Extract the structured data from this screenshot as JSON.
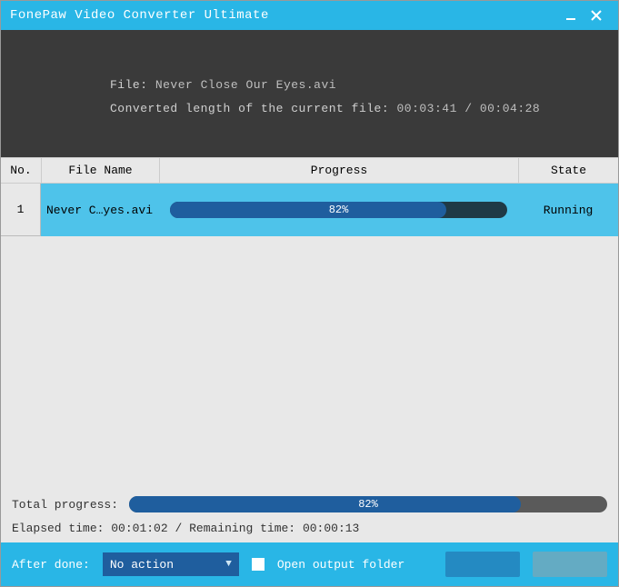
{
  "colors": {
    "accent": "#29b6e6",
    "primary": "#1f5e9e",
    "panel_bg": "#3a3a3a"
  },
  "window": {
    "title": "FonePaw Video Converter Ultimate"
  },
  "info": {
    "file_label": "File:",
    "file_name": "Never Close Our Eyes.avi",
    "length_label": "Converted length of the current file:",
    "elapsed": "00:03:41",
    "total": "00:04:28",
    "sep": "/"
  },
  "table": {
    "headers": {
      "no": "No.",
      "file": "File Name",
      "progress": "Progress",
      "state": "State"
    },
    "rows": [
      {
        "no": "1",
        "file": "Never C…yes.avi",
        "progress_pct": 82,
        "progress_label": "82%",
        "state": "Running",
        "selected": true
      }
    ]
  },
  "total": {
    "label": "Total progress:",
    "pct": 82,
    "pct_label": "82%"
  },
  "timing": {
    "elapsed_label": "Elapsed time:",
    "elapsed": "00:01:02",
    "sep": "/",
    "remaining_label": "Remaining time:",
    "remaining": "00:00:13"
  },
  "footer": {
    "after_done_label": "After done:",
    "after_done_value": "No action",
    "open_output_label": "Open output folder",
    "open_output_checked": false
  }
}
